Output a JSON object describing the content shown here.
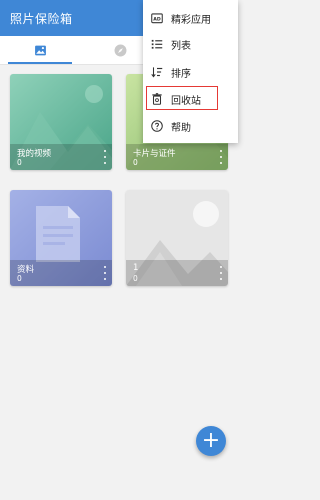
{
  "app": {
    "title": "照片保险箱"
  },
  "tabs": [
    {
      "id": "photos",
      "icon": "photo-icon",
      "active": true
    },
    {
      "id": "explore",
      "icon": "compass-icon",
      "active": false
    }
  ],
  "albums": [
    {
      "name": "我的视频",
      "count": "0",
      "icon": "more-vert-icon"
    },
    {
      "name": "卡片与证件",
      "count": "0",
      "icon": "more-vert-icon"
    },
    {
      "name": "资料",
      "count": "0",
      "icon": "more-vert-icon"
    },
    {
      "name": "1",
      "count": "0",
      "icon": "more-vert-icon"
    }
  ],
  "menu": {
    "items": [
      {
        "label": "精彩应用",
        "icon": "ad-icon"
      },
      {
        "label": "列表",
        "icon": "list-icon"
      },
      {
        "label": "排序",
        "icon": "sort-icon"
      },
      {
        "label": "回收站",
        "icon": "recycle-bin-icon",
        "highlighted": true
      },
      {
        "label": "帮助",
        "icon": "help-icon"
      }
    ]
  },
  "fab": {
    "label": "+",
    "icon": "plus-icon"
  },
  "colors": {
    "primary": "#3f87d6",
    "highlight_border": "#e53935",
    "background": "#f2f2f2"
  }
}
